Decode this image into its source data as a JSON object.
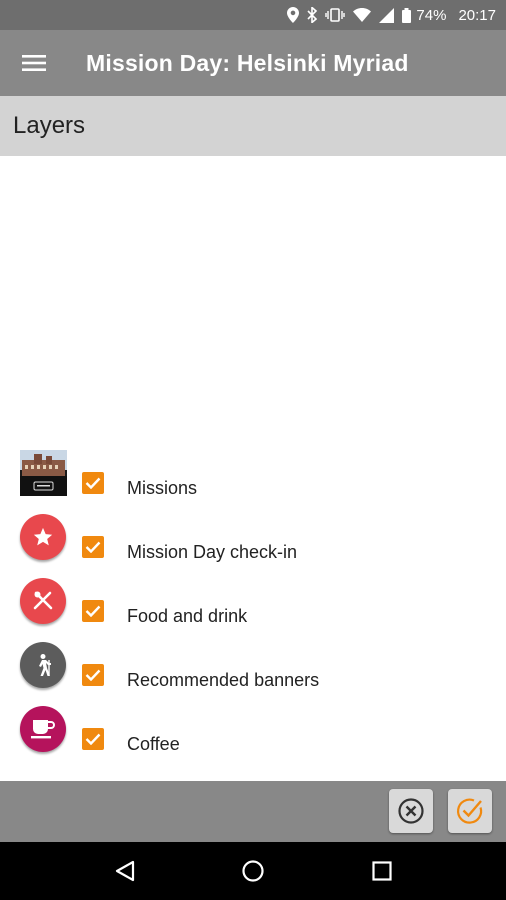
{
  "status_bar": {
    "battery": "74%",
    "time": "20:17",
    "icons": [
      "location-icon",
      "bluetooth-icon",
      "vibrate-icon",
      "wifi-icon",
      "signal-icon",
      "battery-icon"
    ]
  },
  "app_bar": {
    "title": "Mission Day: Helsinki Myriad",
    "menu_icon": "hamburger-menu-icon"
  },
  "section": {
    "title": "Layers"
  },
  "layers": [
    {
      "label": "Missions",
      "icon": "mission-photo-thumbnail",
      "checked": true
    },
    {
      "label": "Mission Day check-in",
      "icon": "star-icon",
      "icon_color": "#e8484d",
      "checked": true
    },
    {
      "label": "Food and drink",
      "icon": "fork-knife-icon",
      "icon_color": "#e8484d",
      "checked": true
    },
    {
      "label": "Recommended banners",
      "icon": "hiker-icon",
      "icon_color": "#5c5c5c",
      "checked": true
    },
    {
      "label": "Coffee",
      "icon": "coffee-cup-icon",
      "icon_color": "#b5135c",
      "checked": true
    }
  ],
  "actions": {
    "cancel_icon": "close-circle-icon",
    "confirm_icon": "check-circle-icon"
  },
  "nav_bar": {
    "icons": [
      "back-icon",
      "home-icon",
      "recents-icon"
    ]
  },
  "colors": {
    "checkbox": "#f0890f",
    "app_bar": "#888888",
    "status_bar": "#6e6e6e",
    "section_header": "#d3d3d3"
  }
}
